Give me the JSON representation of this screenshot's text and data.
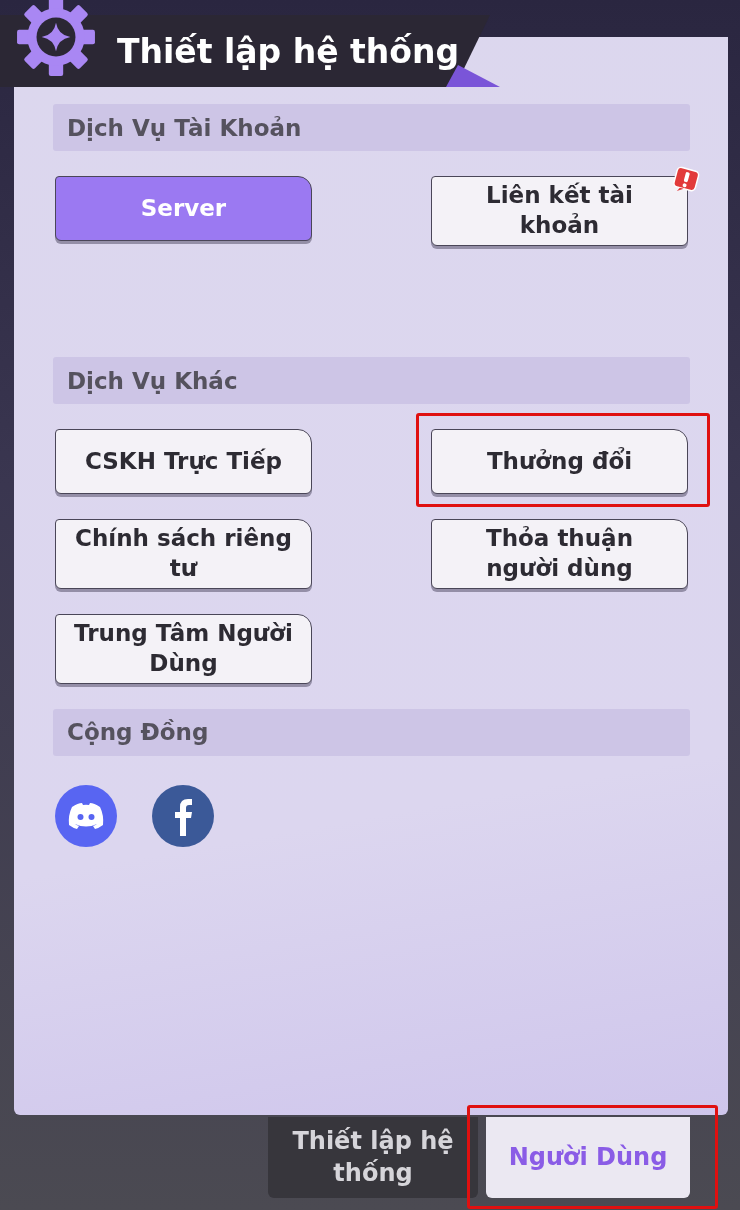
{
  "header": {
    "title": "Thiết lập hệ thống"
  },
  "sections": [
    {
      "title": "Dịch Vụ Tài Khoản",
      "buttons": [
        {
          "label": "Server",
          "kind": "primary",
          "alert": false,
          "highlighted": false
        },
        {
          "label": "Liên kết tài khoản",
          "kind": "normal",
          "alert": true,
          "highlighted": false
        }
      ]
    },
    {
      "title": "Dịch Vụ Khác",
      "buttons": [
        {
          "label": "CSKH Trực Tiếp",
          "kind": "normal",
          "alert": false,
          "highlighted": false
        },
        {
          "label": "Thưởng đổi",
          "kind": "normal",
          "alert": false,
          "highlighted": true
        },
        {
          "label": "Chính sách riêng tư",
          "kind": "normal",
          "alert": false,
          "highlighted": false
        },
        {
          "label": "Thỏa thuận người dùng",
          "kind": "normal",
          "alert": false,
          "highlighted": false
        },
        {
          "label": "Trung Tâm Người Dùng",
          "kind": "normal",
          "alert": false,
          "highlighted": false
        }
      ]
    }
  ],
  "community": {
    "title": "Cộng Đồng",
    "links": [
      {
        "kind": "discord"
      },
      {
        "kind": "facebook"
      }
    ]
  },
  "tabs": [
    {
      "label": "Thiết lập hệ thống",
      "selected": false,
      "highlighted": false
    },
    {
      "label": "Người Dùng",
      "selected": true,
      "highlighted": true
    }
  ]
}
